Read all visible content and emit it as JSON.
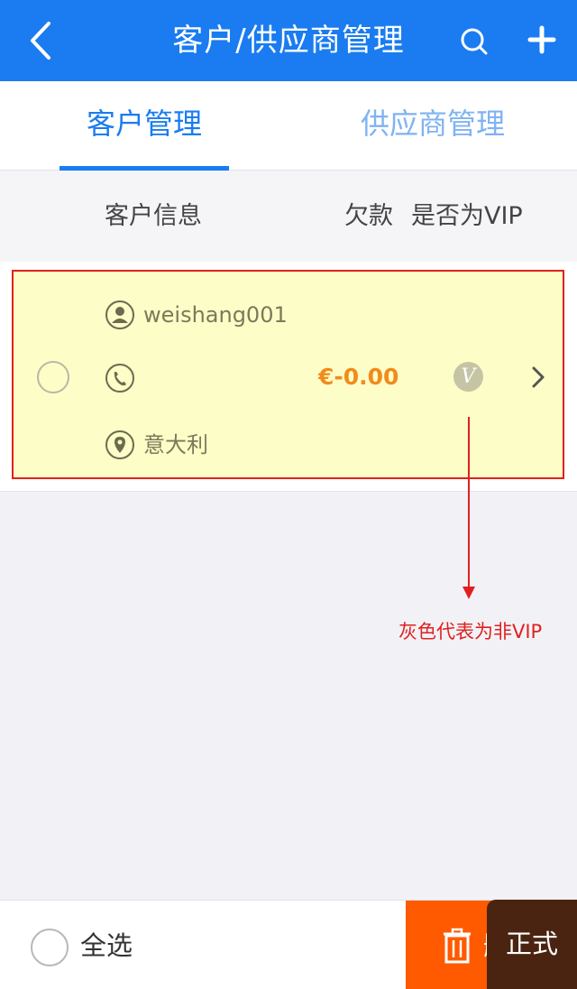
{
  "nav": {
    "title": "客户/供应商管理",
    "back_icon": "chevron-left-icon",
    "search_icon": "search-icon",
    "add_icon": "plus-icon",
    "bg_color": "#1a7cf0"
  },
  "tabs": [
    {
      "label": "客户管理",
      "active": true
    },
    {
      "label": "供应商管理",
      "active": false
    }
  ],
  "columns": {
    "info": "客户信息",
    "debt": "欠款",
    "vip": "是否为VIP"
  },
  "customers": [
    {
      "name": "weishang001",
      "phone": "",
      "location": "意大利",
      "debt": "€-0.00",
      "vip_label": "V",
      "is_vip": false,
      "selected": false
    }
  ],
  "annotation": {
    "text": "灰色代表为非VIP",
    "color": "#e02020"
  },
  "bottom": {
    "select_all": "全选",
    "delete_label": "删除",
    "delete_color": "#ff5a00"
  },
  "badge": {
    "label": "正式"
  }
}
